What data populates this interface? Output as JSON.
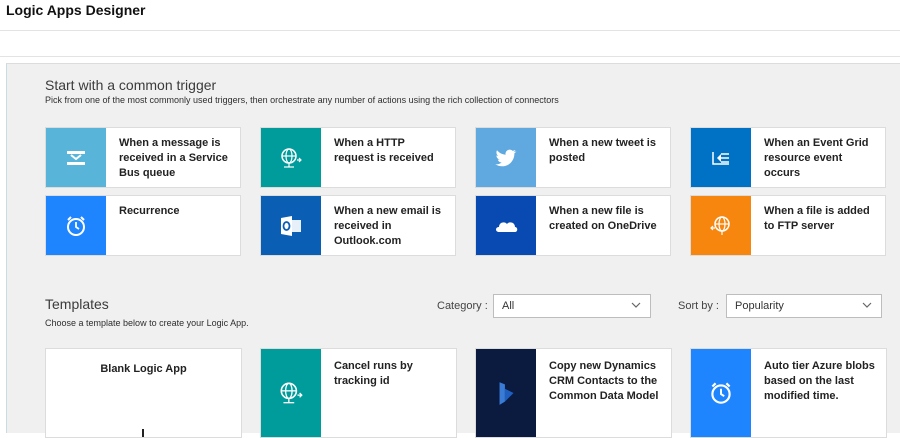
{
  "app": {
    "title": "Logic Apps Designer"
  },
  "triggers": {
    "heading": "Start with a common trigger",
    "subtitle": "Pick from one of the most commonly used triggers, then orchestrate any number of actions using the rich collection of connectors",
    "cards": [
      {
        "label": "When a message is received in a Service Bus queue",
        "icon": "service-bus-icon",
        "color": "#59b4d9"
      },
      {
        "label": "When a HTTP request is received",
        "icon": "http-globe-icon",
        "color": "#009b9b"
      },
      {
        "label": "When a new tweet is posted",
        "icon": "twitter-icon",
        "color": "#5fa8e0"
      },
      {
        "label": "When an Event Grid resource event occurs",
        "icon": "event-grid-icon",
        "color": "#0072c6"
      },
      {
        "label": "Recurrence",
        "icon": "alarm-clock-icon",
        "color": "#1f85ff"
      },
      {
        "label": "When a new email is received in Outlook.com",
        "icon": "outlook-icon",
        "color": "#0a5fb4"
      },
      {
        "label": "When a new file is created on OneDrive",
        "icon": "onedrive-icon",
        "color": "#094ab2"
      },
      {
        "label": "When a file is added to FTP server",
        "icon": "ftp-globe-icon",
        "color": "#f7860e"
      }
    ]
  },
  "templates": {
    "heading": "Templates",
    "subtitle": "Choose a template below to create your Logic App.",
    "category_label": "Category :",
    "category_value": "All",
    "sort_label": "Sort by :",
    "sort_value": "Popularity",
    "cards": [
      {
        "label": "Blank Logic App",
        "icon": "",
        "color": "#ffffff"
      },
      {
        "label": "Cancel runs by tracking id",
        "icon": "http-globe-icon",
        "color": "#009b9b"
      },
      {
        "label": "Copy new Dynamics CRM Contacts to the Common Data Model",
        "icon": "dynamics-icon",
        "color": "#0b1a3f"
      },
      {
        "label": "Auto tier Azure blobs based on the last modified time.",
        "icon": "alarm-clock-icon",
        "color": "#1f85ff"
      }
    ]
  }
}
